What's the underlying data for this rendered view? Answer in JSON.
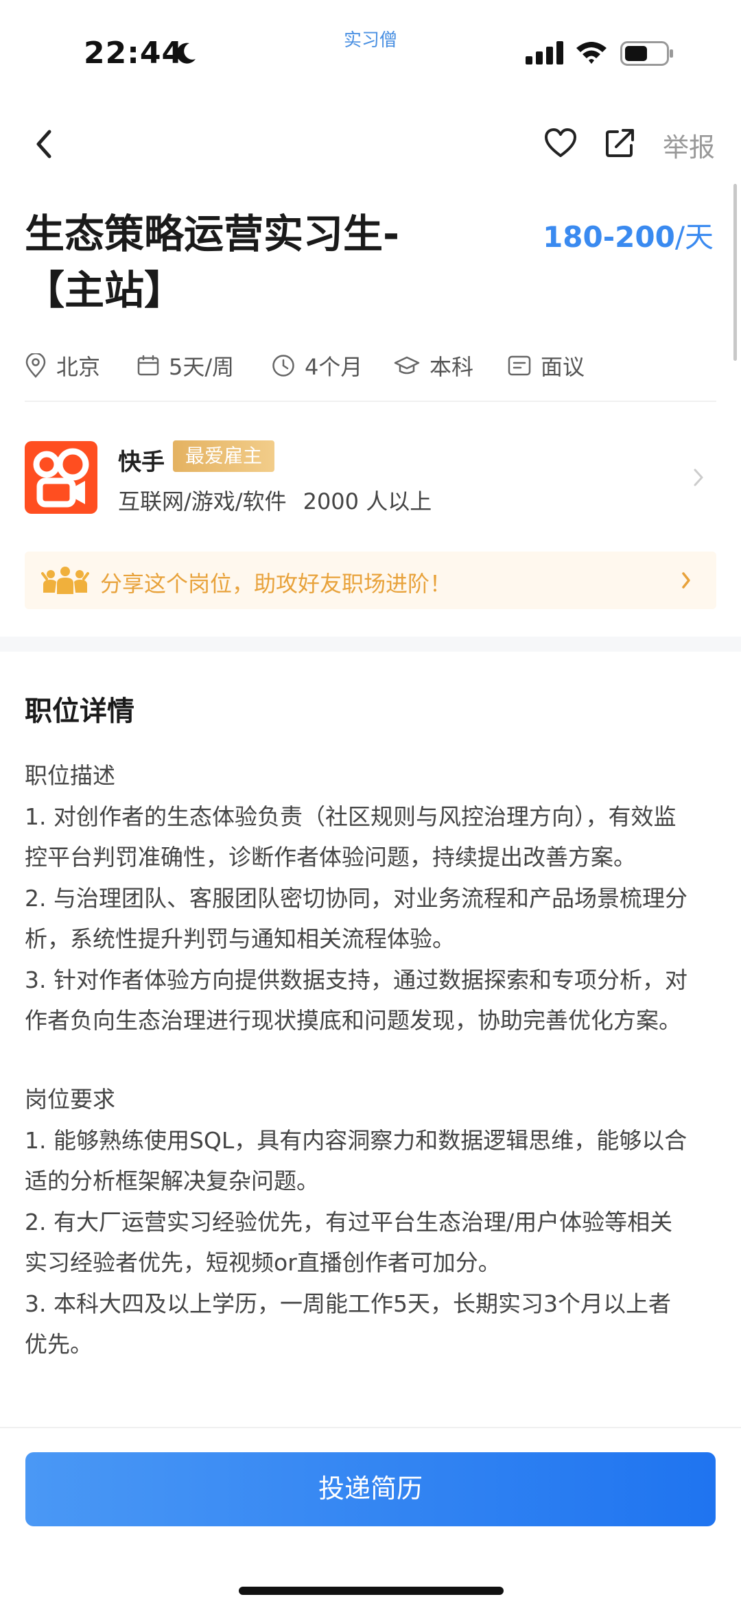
{
  "status_bar": {
    "time": "22:44",
    "app_watermark": "实习僧"
  },
  "nav": {
    "report_label": "举报"
  },
  "job": {
    "title_line1": "生态策略运营实习生-",
    "title_line2": "【主站】",
    "salary_range": "180-200",
    "salary_unit": "/天",
    "tags": {
      "location": "北京",
      "days_per_week": "5天/周",
      "duration": "4个月",
      "education": "本科",
      "interview": "面议"
    }
  },
  "company": {
    "name": "快手",
    "badge": "最爱雇主",
    "industry": "互联网/游戏/软件",
    "size": "2000 人以上",
    "brand_color": "#ff4e20"
  },
  "share_banner": {
    "text": "分享这个岗位，助攻好友职场进阶！"
  },
  "detail": {
    "section_title": "职位详情",
    "description_lines": [
      "职位描述",
      "1. 对创作者的生态体验负责（社区规则与风控治理方向），有效监",
      "控平台判罚准确性，诊断作者体验问题，持续提出改善方案。",
      "2. 与治理团队、客服团队密切协同，对业务流程和产品场景梳理分",
      "析，系统性提升判罚与通知相关流程体验。",
      "3. 针对作者体验方向提供数据支持，通过数据探索和专项分析，对",
      "作者负向生态治理进行现状摸底和问题发现，协助完善优化方案。"
    ],
    "requirement_lines": [
      "岗位要求",
      "1. 能够熟练使用SQL，具有内容洞察力和数据逻辑思维，能够以合",
      "适的分析框架解决复杂问题。",
      "2. 有大厂运营实习经验优先，有过平台生态治理/用户体验等相关",
      "实习经验者优先，短视频or直播创作者可加分。",
      "3. 本科大四及以上学历，一周能工作5天，长期实习3个月以上者",
      "优先。"
    ]
  },
  "footer": {
    "apply_label": "投递简历"
  },
  "colors": {
    "accent_blue": "#3a8af0",
    "badge_gold": "#e4b261",
    "share_orange": "#e8a23b"
  }
}
